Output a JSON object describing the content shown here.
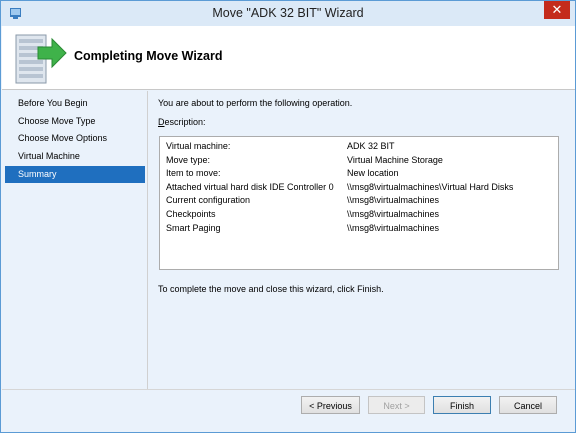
{
  "window": {
    "title": "Move \"ADK 32 BIT\" Wizard",
    "close_glyph": "✕"
  },
  "header": {
    "title": "Completing Move Wizard"
  },
  "nav": {
    "items": [
      {
        "label": "Before You Begin"
      },
      {
        "label": "Choose Move Type"
      },
      {
        "label": "Choose Move Options"
      },
      {
        "label": "Virtual Machine"
      },
      {
        "label": "Summary"
      }
    ],
    "selected": "Summary"
  },
  "content": {
    "intro": "You are about to perform the following operation.",
    "description_label_prefix": "D",
    "description_label_rest": "escription:",
    "rows": [
      {
        "key": "Virtual machine:",
        "value": "ADK 32 BIT"
      },
      {
        "key": "Move type:",
        "value": "Virtual Machine Storage"
      },
      {
        "key": "Item to move:",
        "value": "New location"
      },
      {
        "key": "Attached virtual hard disk  IDE Controller 0",
        "value": "\\\\msg8\\virtualmachines\\Virtual Hard Disks"
      },
      {
        "key": "Current configuration",
        "value": "\\\\msg8\\virtualmachines"
      },
      {
        "key": "Checkpoints",
        "value": "\\\\msg8\\virtualmachines"
      },
      {
        "key": "Smart Paging",
        "value": "\\\\msg8\\virtualmachines"
      }
    ],
    "closing": "To complete the move and close this wizard, click Finish."
  },
  "buttons": {
    "previous": "< Previous",
    "next": "Next >",
    "finish": "Finish",
    "cancel": "Cancel"
  },
  "colors": {
    "accent": "#1f6fbf",
    "close": "#c42b1c",
    "frame": "#dbe9f7",
    "body": "#eaf2fb"
  }
}
